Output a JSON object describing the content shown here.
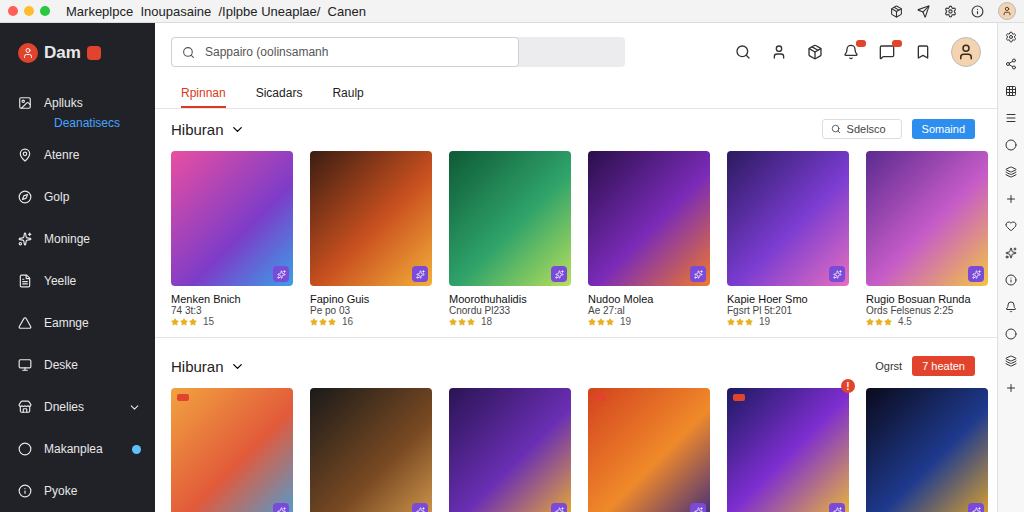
{
  "window": {
    "title": "Markeplpce  Inoupasaine  /Iplpbe Uneaplae/  Canen"
  },
  "sidebar": {
    "logo": "Dam",
    "items": [
      {
        "label": "Aplluks",
        "kind": "item",
        "selected": false,
        "expandable": false,
        "dot": false
      },
      {
        "label": "Deanatisecs",
        "kind": "subitem",
        "selected": true,
        "expandable": false,
        "dot": false
      },
      {
        "label": "Atenre",
        "kind": "item",
        "selected": false,
        "expandable": false,
        "dot": false
      },
      {
        "label": "Golp",
        "kind": "item",
        "selected": false,
        "expandable": false,
        "dot": false
      },
      {
        "label": "Moninge",
        "kind": "item",
        "selected": false,
        "expandable": false,
        "dot": false
      },
      {
        "label": "Yeelle",
        "kind": "item",
        "selected": false,
        "expandable": false,
        "dot": false
      },
      {
        "label": "Eamnge",
        "kind": "item",
        "selected": false,
        "expandable": false,
        "dot": false
      },
      {
        "label": "Deske",
        "kind": "item",
        "selected": false,
        "expandable": false,
        "dot": false
      },
      {
        "label": "Dnelies",
        "kind": "item",
        "selected": false,
        "expandable": true,
        "dot": false
      },
      {
        "label": "Makanplea",
        "kind": "item",
        "selected": false,
        "expandable": false,
        "dot": true
      },
      {
        "label": "Pyoke",
        "kind": "item",
        "selected": false,
        "expandable": false,
        "dot": false
      }
    ]
  },
  "search": {
    "placeholder": "Sappairo (oolinsamanh"
  },
  "tabs": [
    {
      "label": "Rpinnan",
      "selected": true
    },
    {
      "label": "Sicadars",
      "selected": false
    },
    {
      "label": "Raulp",
      "selected": false
    }
  ],
  "sections": [
    {
      "title": "Hiburan",
      "action": {
        "kind": "search",
        "text": "Sdelsco",
        "button": "Somaind"
      },
      "cards": [
        {
          "title": "Menken Bnich",
          "subtitle": "74 3t:3",
          "stars": 3,
          "rating": "15",
          "tagged": false,
          "badge": ""
        },
        {
          "title": "Fapino Guis",
          "subtitle": "Pe po 03",
          "stars": 3,
          "rating": "16",
          "tagged": false,
          "badge": ""
        },
        {
          "title": "Moorothuhalidis",
          "subtitle": "Cnordu Pl233",
          "stars": 3,
          "rating": "18",
          "tagged": false,
          "badge": ""
        },
        {
          "title": "Nudoo Molea",
          "subtitle": "Ae 27:al",
          "stars": 3,
          "rating": "19",
          "tagged": false,
          "badge": ""
        },
        {
          "title": "Kapie Hoer Smo",
          "subtitle": "Fgsrt Pl 5t:201",
          "stars": 3,
          "rating": "19",
          "tagged": false,
          "badge": ""
        },
        {
          "title": "Rugio Bosuan Runda",
          "subtitle": "Ords Felsenus 2:25",
          "stars": 3,
          "rating": "4.5",
          "tagged": false,
          "badge": ""
        }
      ]
    },
    {
      "title": "Hiburan",
      "action": {
        "kind": "sort",
        "text": "Ogrst",
        "button": "7 heaten"
      },
      "cards": [
        {
          "title": "",
          "subtitle": "",
          "stars": 0,
          "rating": "",
          "tagged": true,
          "badge": ""
        },
        {
          "title": "",
          "subtitle": "",
          "stars": 0,
          "rating": "",
          "tagged": false,
          "badge": ""
        },
        {
          "title": "",
          "subtitle": "",
          "stars": 0,
          "rating": "",
          "tagged": false,
          "badge": ""
        },
        {
          "title": "",
          "subtitle": "",
          "stars": 0,
          "rating": "",
          "tagged": true,
          "badge": ""
        },
        {
          "title": "",
          "subtitle": "",
          "stars": 0,
          "rating": "",
          "tagged": true,
          "badge": "!"
        },
        {
          "title": "",
          "subtitle": "",
          "stars": 0,
          "rating": "",
          "tagged": false,
          "badge": ""
        }
      ]
    }
  ]
}
